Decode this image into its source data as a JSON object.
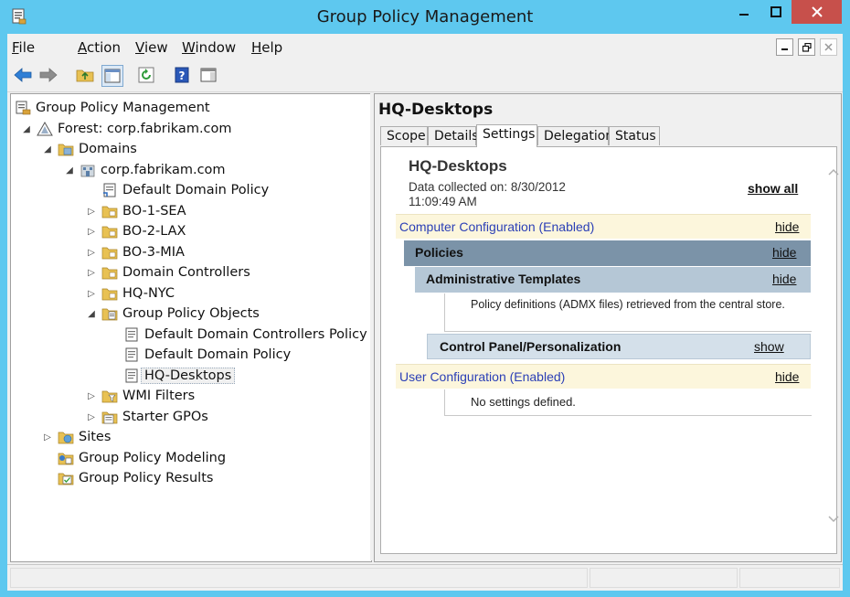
{
  "window": {
    "title": "Group Policy Management"
  },
  "menu": {
    "items": [
      {
        "label": "File",
        "accel": "F",
        "rest": "ile"
      },
      {
        "label": "Action",
        "accel": "A",
        "rest": "ction"
      },
      {
        "label": "View",
        "accel": "V",
        "rest": "iew"
      },
      {
        "label": "Window",
        "accel": "W",
        "rest": "indow"
      },
      {
        "label": "Help",
        "accel": "H",
        "rest": "elp"
      }
    ]
  },
  "tree": {
    "items": [
      {
        "label": "Group Policy Management",
        "expander": "",
        "icon": "gpmc-icon"
      },
      {
        "label": "Forest: corp.fabrikam.com",
        "expander": "◢",
        "icon": "forest-icon"
      },
      {
        "label": "Domains",
        "expander": "◢",
        "icon": "domains-folder-icon"
      },
      {
        "label": "corp.fabrikam.com",
        "expander": "◢",
        "icon": "domain-icon"
      },
      {
        "label": "Default Domain Policy",
        "expander": "",
        "icon": "gpo-link-icon"
      },
      {
        "label": "BO-1-SEA",
        "expander": "▷",
        "icon": "ou-folder-icon"
      },
      {
        "label": "BO-2-LAX",
        "expander": "▷",
        "icon": "ou-folder-icon"
      },
      {
        "label": "BO-3-MIA",
        "expander": "▷",
        "icon": "ou-folder-icon"
      },
      {
        "label": "Domain Controllers",
        "expander": "▷",
        "icon": "ou-folder-icon"
      },
      {
        "label": "HQ-NYC",
        "expander": "▷",
        "icon": "ou-folder-icon"
      },
      {
        "label": "Group Policy Objects",
        "expander": "◢",
        "icon": "gpo-folder-icon"
      },
      {
        "label": "Default Domain Controllers Policy",
        "expander": "",
        "icon": "gpo-icon"
      },
      {
        "label": "Default Domain Policy",
        "expander": "",
        "icon": "gpo-icon"
      },
      {
        "label": "HQ-Desktops",
        "expander": "",
        "icon": "gpo-icon",
        "selected": true
      },
      {
        "label": "WMI Filters",
        "expander": "▷",
        "icon": "wmi-folder-icon"
      },
      {
        "label": "Starter GPOs",
        "expander": "▷",
        "icon": "starter-gpo-icon"
      },
      {
        "label": "Sites",
        "expander": "▷",
        "icon": "sites-icon"
      },
      {
        "label": "Group Policy Modeling",
        "expander": "",
        "icon": "modeling-icon"
      },
      {
        "label": "Group Policy Results",
        "expander": "",
        "icon": "results-icon"
      }
    ]
  },
  "details": {
    "title": "HQ-Desktops",
    "tabs": [
      "Scope",
      "Details",
      "Settings",
      "Delegation",
      "Status"
    ],
    "active_tab": "Settings",
    "report": {
      "heading": "HQ-Desktops",
      "collected_line1": "Data collected on: 8/30/2012",
      "collected_line2": "11:09:49 AM",
      "show_all": "show all",
      "computer_config": {
        "label": "Computer Configuration (Enabled)",
        "link": "hide"
      },
      "policies": {
        "label": "Policies",
        "link": "hide"
      },
      "admin_templates": {
        "label": "Administrative Templates",
        "link": "hide"
      },
      "admx_note": "Policy definitions (ADMX files) retrieved from the central store.",
      "control_panel": {
        "label": "Control Panel/Personalization",
        "link": "show"
      },
      "user_config": {
        "label": "User Configuration (Enabled)",
        "link": "hide"
      },
      "no_settings": "No settings defined."
    }
  },
  "colors": {
    "titlebar": "#5ec8ef",
    "close_button": "#c7504b",
    "config_band": "#fcf6dc",
    "config_text": "#2b3fb6",
    "policies_band": "#7b93a8",
    "admin_band": "#b5c7d6",
    "cp_band": "#d4e0ea"
  }
}
